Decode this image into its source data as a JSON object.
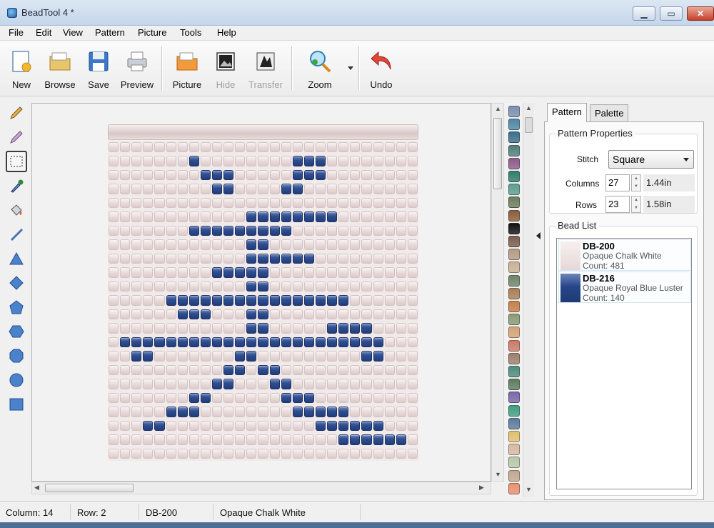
{
  "window": {
    "title": "BeadTool 4 *"
  },
  "menu": [
    "File",
    "Edit",
    "View",
    "Pattern",
    "Picture",
    "Tools",
    "Help"
  ],
  "toolbar": {
    "new": "New",
    "browse": "Browse",
    "save": "Save",
    "preview": "Preview",
    "picture": "Picture",
    "hide": "Hide",
    "transfer": "Transfer",
    "zoom": "Zoom",
    "undo": "Undo"
  },
  "panel": {
    "tabs": [
      "Pattern",
      "Palette"
    ],
    "properties_title": "Pattern Properties",
    "stitch_label": "Stitch",
    "stitch_value": "Square",
    "columns_label": "Columns",
    "columns_value": "27",
    "columns_unit": "1.44in",
    "rows_label": "Rows",
    "rows_value": "23",
    "rows_unit": "1.58in",
    "bead_list_title": "Bead List",
    "beads": [
      {
        "code": "DB-200",
        "name": "Opaque Chalk White",
        "count": "Count: 481",
        "color": "#ece0e0"
      },
      {
        "code": "DB-216",
        "name": "Opaque Royal Blue Luster",
        "count": "Count: 140",
        "color": "#2b4c8e"
      }
    ]
  },
  "status": {
    "column": "Column: 14",
    "row": "Row: 2",
    "code": "DB-200",
    "name": "Opaque Chalk White"
  },
  "pattern": {
    "columns": 27,
    "rows": 23,
    "blue_cells": [
      [
        1,
        7
      ],
      [
        1,
        16
      ],
      [
        1,
        17
      ],
      [
        1,
        18
      ],
      [
        2,
        8
      ],
      [
        2,
        9
      ],
      [
        2,
        10
      ],
      [
        2,
        16
      ],
      [
        2,
        17
      ],
      [
        2,
        18
      ],
      [
        3,
        9
      ],
      [
        3,
        10
      ],
      [
        3,
        15
      ],
      [
        3,
        16
      ],
      [
        5,
        12
      ],
      [
        5,
        13
      ],
      [
        5,
        14
      ],
      [
        5,
        15
      ],
      [
        5,
        16
      ],
      [
        5,
        17
      ],
      [
        5,
        18
      ],
      [
        5,
        19
      ],
      [
        6,
        7
      ],
      [
        6,
        8
      ],
      [
        6,
        9
      ],
      [
        6,
        10
      ],
      [
        6,
        11
      ],
      [
        6,
        12
      ],
      [
        6,
        13
      ],
      [
        6,
        14
      ],
      [
        6,
        15
      ],
      [
        7,
        12
      ],
      [
        7,
        13
      ],
      [
        8,
        12
      ],
      [
        8,
        13
      ],
      [
        8,
        14
      ],
      [
        8,
        15
      ],
      [
        8,
        16
      ],
      [
        8,
        17
      ],
      [
        9,
        9
      ],
      [
        9,
        10
      ],
      [
        9,
        11
      ],
      [
        9,
        12
      ],
      [
        9,
        13
      ],
      [
        10,
        12
      ],
      [
        10,
        13
      ],
      [
        11,
        5
      ],
      [
        11,
        6
      ],
      [
        11,
        7
      ],
      [
        11,
        8
      ],
      [
        11,
        9
      ],
      [
        11,
        10
      ],
      [
        11,
        11
      ],
      [
        11,
        12
      ],
      [
        11,
        13
      ],
      [
        11,
        14
      ],
      [
        11,
        15
      ],
      [
        11,
        16
      ],
      [
        11,
        17
      ],
      [
        11,
        18
      ],
      [
        11,
        19
      ],
      [
        11,
        20
      ],
      [
        12,
        6
      ],
      [
        12,
        7
      ],
      [
        12,
        8
      ],
      [
        12,
        12
      ],
      [
        12,
        13
      ],
      [
        13,
        12
      ],
      [
        13,
        13
      ],
      [
        13,
        19
      ],
      [
        13,
        20
      ],
      [
        13,
        21
      ],
      [
        13,
        22
      ],
      [
        14,
        1
      ],
      [
        14,
        2
      ],
      [
        14,
        3
      ],
      [
        14,
        4
      ],
      [
        14,
        5
      ],
      [
        14,
        6
      ],
      [
        14,
        7
      ],
      [
        14,
        8
      ],
      [
        14,
        9
      ],
      [
        14,
        10
      ],
      [
        14,
        11
      ],
      [
        14,
        12
      ],
      [
        14,
        13
      ],
      [
        14,
        14
      ],
      [
        14,
        15
      ],
      [
        14,
        16
      ],
      [
        14,
        17
      ],
      [
        14,
        18
      ],
      [
        14,
        19
      ],
      [
        14,
        20
      ],
      [
        14,
        21
      ],
      [
        14,
        22
      ],
      [
        14,
        23
      ],
      [
        15,
        2
      ],
      [
        15,
        3
      ],
      [
        15,
        11
      ],
      [
        15,
        12
      ],
      [
        15,
        22
      ],
      [
        15,
        23
      ],
      [
        16,
        10
      ],
      [
        16,
        11
      ],
      [
        16,
        13
      ],
      [
        16,
        14
      ],
      [
        17,
        9
      ],
      [
        17,
        10
      ],
      [
        17,
        14
      ],
      [
        17,
        15
      ],
      [
        18,
        7
      ],
      [
        18,
        8
      ],
      [
        18,
        15
      ],
      [
        18,
        16
      ],
      [
        18,
        17
      ],
      [
        19,
        5
      ],
      [
        19,
        6
      ],
      [
        19,
        7
      ],
      [
        19,
        16
      ],
      [
        19,
        17
      ],
      [
        19,
        18
      ],
      [
        19,
        19
      ],
      [
        19,
        20
      ],
      [
        20,
        3
      ],
      [
        20,
        4
      ],
      [
        20,
        18
      ],
      [
        20,
        19
      ],
      [
        20,
        20
      ],
      [
        20,
        21
      ],
      [
        20,
        22
      ],
      [
        20,
        23
      ],
      [
        21,
        20
      ],
      [
        21,
        21
      ],
      [
        21,
        22
      ],
      [
        21,
        23
      ],
      [
        21,
        24
      ],
      [
        21,
        25
      ]
    ]
  },
  "palette_colors": [
    "#7b8fb0",
    "#4e87a3",
    "#3b6f8a",
    "#4f7f7a",
    "#8e5a8a",
    "#2e7d6b",
    "#5e9e8f",
    "#6b7d5c",
    "#8a5d3c",
    "#111111",
    "#7a5c4f",
    "#b39a86",
    "#c9b196",
    "#6d8569",
    "#a77f55",
    "#c57f4a",
    "#8a9a76",
    "#d3a276",
    "#c97a67",
    "#9e7f6c",
    "#4e8c7a",
    "#5d7d5f",
    "#7967a6",
    "#3f9e82",
    "#5a7d9a",
    "#e0c070",
    "#d8b8a0",
    "#b8c8a8",
    "#c0a890",
    "#e89070"
  ]
}
